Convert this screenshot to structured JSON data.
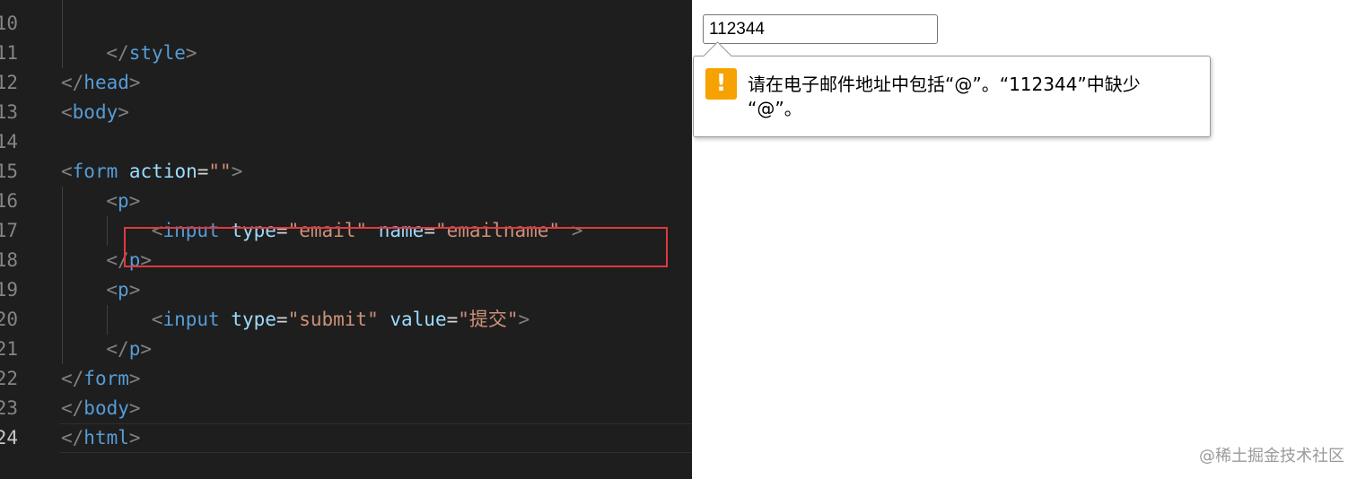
{
  "editor": {
    "lines": [
      {
        "num": "10",
        "indent": "",
        "tokens": []
      },
      {
        "num": "11",
        "indent": "    ",
        "tokens": [
          {
            "c": "t-punc",
            "t": "</"
          },
          {
            "c": "t-tag",
            "t": "style"
          },
          {
            "c": "t-punc",
            "t": ">"
          }
        ]
      },
      {
        "num": "12",
        "indent": "",
        "tokens": [
          {
            "c": "t-punc",
            "t": "</"
          },
          {
            "c": "t-tag",
            "t": "head"
          },
          {
            "c": "t-punc",
            "t": ">"
          }
        ]
      },
      {
        "num": "13",
        "indent": "",
        "tokens": [
          {
            "c": "t-punc",
            "t": "<"
          },
          {
            "c": "t-tag",
            "t": "body"
          },
          {
            "c": "t-punc",
            "t": ">"
          }
        ]
      },
      {
        "num": "14",
        "indent": "",
        "tokens": []
      },
      {
        "num": "15",
        "indent": "",
        "tokens": [
          {
            "c": "t-punc",
            "t": "<"
          },
          {
            "c": "t-tag",
            "t": "form"
          },
          {
            "c": "t-eq",
            "t": " "
          },
          {
            "c": "t-attr",
            "t": "action"
          },
          {
            "c": "t-eq",
            "t": "="
          },
          {
            "c": "t-str",
            "t": "\"\""
          },
          {
            "c": "t-punc",
            "t": ">"
          }
        ]
      },
      {
        "num": "16",
        "indent": "    ",
        "tokens": [
          {
            "c": "t-punc",
            "t": "<"
          },
          {
            "c": "t-tag",
            "t": "p"
          },
          {
            "c": "t-punc",
            "t": ">"
          }
        ]
      },
      {
        "num": "17",
        "indent": "        ",
        "tokens": [
          {
            "c": "t-punc",
            "t": "<"
          },
          {
            "c": "t-tag",
            "t": "input"
          },
          {
            "c": "t-eq",
            "t": " "
          },
          {
            "c": "t-attr",
            "t": "type"
          },
          {
            "c": "t-eq",
            "t": "="
          },
          {
            "c": "t-str",
            "t": "\"email\""
          },
          {
            "c": "t-eq",
            "t": " "
          },
          {
            "c": "t-attr",
            "t": "name"
          },
          {
            "c": "t-eq",
            "t": "="
          },
          {
            "c": "t-str",
            "t": "\"emailname\""
          },
          {
            "c": "t-eq",
            "t": " "
          },
          {
            "c": "t-punc",
            "t": ">"
          }
        ]
      },
      {
        "num": "18",
        "indent": "    ",
        "tokens": [
          {
            "c": "t-punc",
            "t": "</"
          },
          {
            "c": "t-tag",
            "t": "p"
          },
          {
            "c": "t-punc",
            "t": ">"
          }
        ]
      },
      {
        "num": "19",
        "indent": "    ",
        "tokens": [
          {
            "c": "t-punc",
            "t": "<"
          },
          {
            "c": "t-tag",
            "t": "p"
          },
          {
            "c": "t-punc",
            "t": ">"
          }
        ]
      },
      {
        "num": "20",
        "indent": "        ",
        "tokens": [
          {
            "c": "t-punc",
            "t": "<"
          },
          {
            "c": "t-tag",
            "t": "input"
          },
          {
            "c": "t-eq",
            "t": " "
          },
          {
            "c": "t-attr",
            "t": "type"
          },
          {
            "c": "t-eq",
            "t": "="
          },
          {
            "c": "t-str",
            "t": "\"submit\""
          },
          {
            "c": "t-eq",
            "t": " "
          },
          {
            "c": "t-attr",
            "t": "value"
          },
          {
            "c": "t-eq",
            "t": "="
          },
          {
            "c": "t-str",
            "t": "\"提交\""
          },
          {
            "c": "t-punc",
            "t": ">"
          }
        ]
      },
      {
        "num": "21",
        "indent": "    ",
        "tokens": [
          {
            "c": "t-punc",
            "t": "</"
          },
          {
            "c": "t-tag",
            "t": "p"
          },
          {
            "c": "t-punc",
            "t": ">"
          }
        ]
      },
      {
        "num": "22",
        "indent": "",
        "tokens": [
          {
            "c": "t-punc",
            "t": "</"
          },
          {
            "c": "t-tag",
            "t": "form"
          },
          {
            "c": "t-punc",
            "t": ">"
          }
        ]
      },
      {
        "num": "23",
        "indent": "",
        "tokens": [
          {
            "c": "t-punc",
            "t": "</"
          },
          {
            "c": "t-tag",
            "t": "body"
          },
          {
            "c": "t-punc",
            "t": ">"
          }
        ]
      },
      {
        "num": "24",
        "indent": "",
        "active": true,
        "tokens": [
          {
            "c": "t-punc",
            "t": "</"
          },
          {
            "c": "t-tag",
            "t": "html"
          },
          {
            "c": "t-punc",
            "t": ">"
          }
        ]
      }
    ]
  },
  "browser": {
    "email_value": "112344",
    "validation": {
      "icon": "warning-icon",
      "icon_glyph": "!",
      "message": "请在电子邮件地址中包括“@”。“112344”中缺少\n“@”。"
    },
    "watermark": "@稀土掘金技术社区"
  },
  "colors": {
    "editor_bg": "#1e1e1e",
    "tag": "#569cd6",
    "attr": "#9cdcfe",
    "string": "#ce9178",
    "punctuation": "#808080",
    "highlight_box": "#e0393e",
    "warning": "#f6a200"
  }
}
